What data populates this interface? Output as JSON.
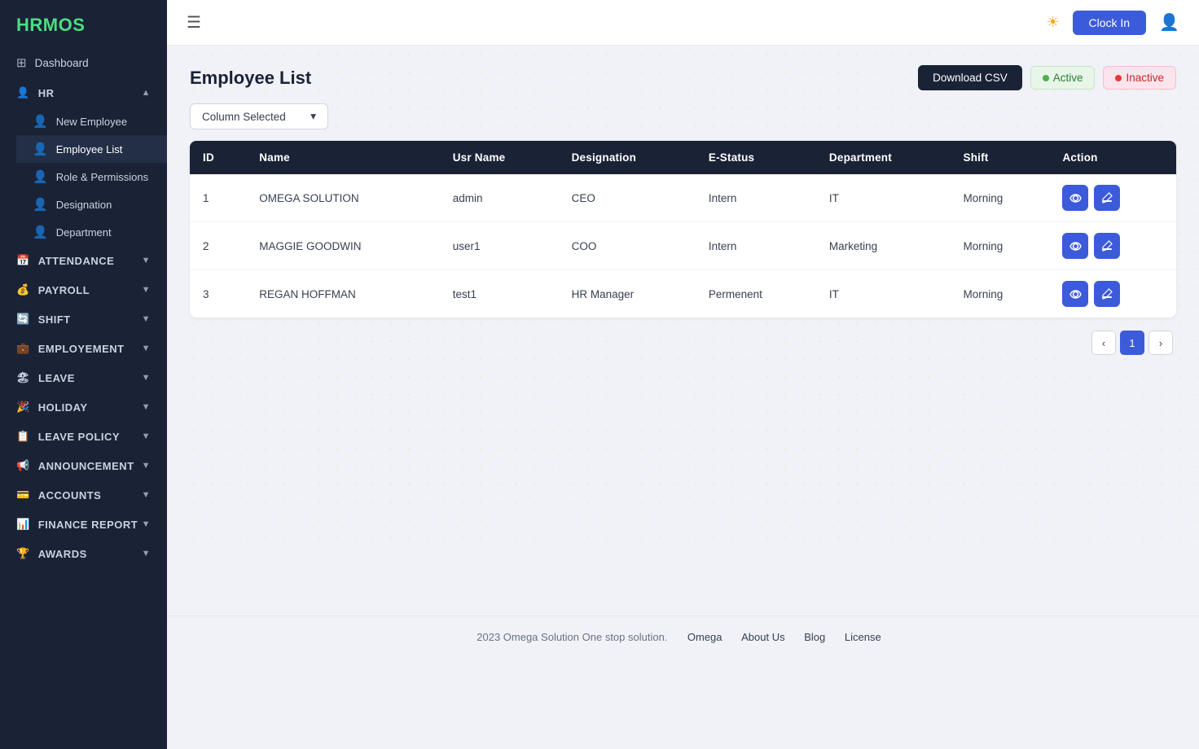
{
  "app": {
    "title": "HRM",
    "title_accent": "OS"
  },
  "header": {
    "clock_btn": "Clock In",
    "theme_icon": "☀"
  },
  "sidebar": {
    "items": [
      {
        "id": "dashboard",
        "label": "Dashboard",
        "icon": "⊞",
        "type": "link"
      },
      {
        "id": "hr",
        "label": "HR",
        "icon": "👤",
        "type": "section",
        "expanded": true
      },
      {
        "id": "new-employee",
        "label": "New Employee",
        "icon": "👤",
        "type": "sub"
      },
      {
        "id": "employee-list",
        "label": "Employee List",
        "icon": "👤",
        "type": "sub",
        "active": true
      },
      {
        "id": "role-permissions",
        "label": "Role & Permissions",
        "icon": "👤",
        "type": "sub"
      },
      {
        "id": "designation",
        "label": "Designation",
        "icon": "👤",
        "type": "sub"
      },
      {
        "id": "department",
        "label": "Department",
        "icon": "👤",
        "type": "sub"
      },
      {
        "id": "attendance",
        "label": "ATTENDANCE",
        "icon": "📅",
        "type": "section"
      },
      {
        "id": "payroll",
        "label": "PAYROLL",
        "icon": "💰",
        "type": "section"
      },
      {
        "id": "shift",
        "label": "SHIFT",
        "icon": "🔄",
        "type": "section"
      },
      {
        "id": "employment",
        "label": "EMPLOYEMENT",
        "icon": "💼",
        "type": "section"
      },
      {
        "id": "leave",
        "label": "LEAVE",
        "icon": "🏖",
        "type": "section"
      },
      {
        "id": "holiday",
        "label": "HOLIDAY",
        "icon": "🎉",
        "type": "section"
      },
      {
        "id": "leave-policy",
        "label": "LEAVE POLICY",
        "icon": "📋",
        "type": "section"
      },
      {
        "id": "announcement",
        "label": "ANNOUNCEMENT",
        "icon": "📢",
        "type": "section"
      },
      {
        "id": "accounts",
        "label": "ACCOUNTS",
        "icon": "💳",
        "type": "section"
      },
      {
        "id": "finance-report",
        "label": "FINANCE REPORT",
        "icon": "📊",
        "type": "section"
      },
      {
        "id": "awards",
        "label": "AWARDS",
        "icon": "🏆",
        "type": "section"
      }
    ]
  },
  "page": {
    "title": "Employee List",
    "download_csv": "Download CSV",
    "column_selected": "Column Selected",
    "active_label": "Active",
    "inactive_label": "Inactive"
  },
  "table": {
    "columns": [
      "ID",
      "Name",
      "Usr Name",
      "Designation",
      "E-Status",
      "Department",
      "Shift",
      "Action"
    ],
    "rows": [
      {
        "id": 1,
        "name": "OMEGA SOLUTION",
        "username": "admin",
        "designation": "CEO",
        "estatus": "Intern",
        "department": "IT",
        "shift": "Morning"
      },
      {
        "id": 2,
        "name": "MAGGIE GOODWIN",
        "username": "user1",
        "designation": "COO",
        "estatus": "Intern",
        "department": "Marketing",
        "shift": "Morning"
      },
      {
        "id": 3,
        "name": "REGAN HOFFMAN",
        "username": "test1",
        "designation": "HR Manager",
        "estatus": "Permenent",
        "department": "IT",
        "shift": "Morning"
      }
    ]
  },
  "pagination": {
    "current": 1,
    "prev": "‹",
    "next": "›"
  },
  "footer": {
    "copyright": "2023 Omega Solution One stop solution.",
    "links": [
      "Omega",
      "About Us",
      "Blog",
      "License"
    ]
  }
}
